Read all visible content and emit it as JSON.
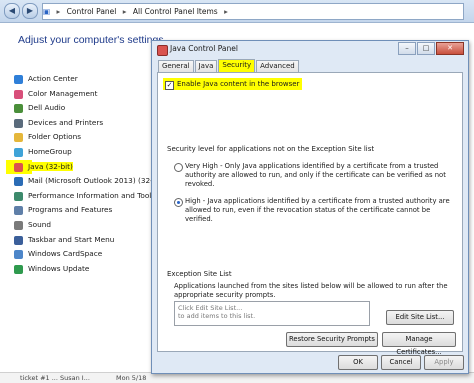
{
  "control_panel": {
    "breadcrumb": [
      "Control Panel",
      "All Control Panel Items"
    ],
    "heading": "Adjust your computer's settings",
    "items": [
      {
        "label": "Action Center",
        "icon": "flag-icon",
        "color": "#2f7fd8"
      },
      {
        "label": "Color Management",
        "icon": "color-icon",
        "color": "#d84f7a"
      },
      {
        "label": "Dell Audio",
        "icon": "audio-icon",
        "color": "#4a8f3a"
      },
      {
        "label": "Devices and Printers",
        "icon": "printer-icon",
        "color": "#5a6b7c"
      },
      {
        "label": "Folder Options",
        "icon": "folder-icon",
        "color": "#e5b73b"
      },
      {
        "label": "HomeGroup",
        "icon": "homegroup-icon",
        "color": "#3fa3d8"
      },
      {
        "label": "Java (32-bit)",
        "icon": "java-icon",
        "color": "#d9534f"
      },
      {
        "label": "Mail (Microsoft Outlook 2013) (32-bit)",
        "icon": "mail-icon",
        "color": "#2b6cb5"
      },
      {
        "label": "Performance Information and Tools",
        "icon": "performance-icon",
        "color": "#3d8a6c"
      },
      {
        "label": "Programs and Features",
        "icon": "programs-icon",
        "color": "#5f7fa8"
      },
      {
        "label": "Sound",
        "icon": "sound-icon",
        "color": "#7a7a7a"
      },
      {
        "label": "Taskbar and Start Menu",
        "icon": "taskbar-icon",
        "color": "#3b5f9a"
      },
      {
        "label": "Windows CardSpace",
        "icon": "cardspace-icon",
        "color": "#4d86c9"
      },
      {
        "label": "Windows Update",
        "icon": "update-icon",
        "color": "#2f9a4e"
      }
    ],
    "taskbar_fragments": [
      "ticket #1 ... Susan I...",
      "Mon 5/18"
    ]
  },
  "java_dialog": {
    "title": "Java Control Panel",
    "window_buttons": {
      "minimize": "–",
      "maximize": "□",
      "close": "✕"
    },
    "tabs": [
      "General",
      "Java",
      "Security",
      "Advanced"
    ],
    "active_tab": "Security",
    "enable_java_label": "Enable Java content in the browser",
    "enable_java_checked": true,
    "security_level_label": "Security level for applications not on the Exception Site list",
    "levels": [
      {
        "text": "Very High - Only Java applications identified by a certificate from a trusted authority are allowed to run, and only if the certificate can be verified as not revoked.",
        "selected": false
      },
      {
        "text": "High - Java applications identified by a certificate from a trusted authority are allowed to run, even if the revocation status of the certificate cannot be verified.",
        "selected": true
      }
    ],
    "exception_label": "Exception Site List",
    "exception_desc": "Applications launched from the sites listed below will be allowed to run after the appropriate security prompts.",
    "site_list_placeholder": "Click Edit Site List...\nto add items to this list.",
    "edit_site_list": "Edit Site List...",
    "restore_prompts": "Restore Security Prompts",
    "manage_certs": "Manage Certificates...",
    "ok": "OK",
    "cancel": "Cancel",
    "apply": "Apply"
  }
}
